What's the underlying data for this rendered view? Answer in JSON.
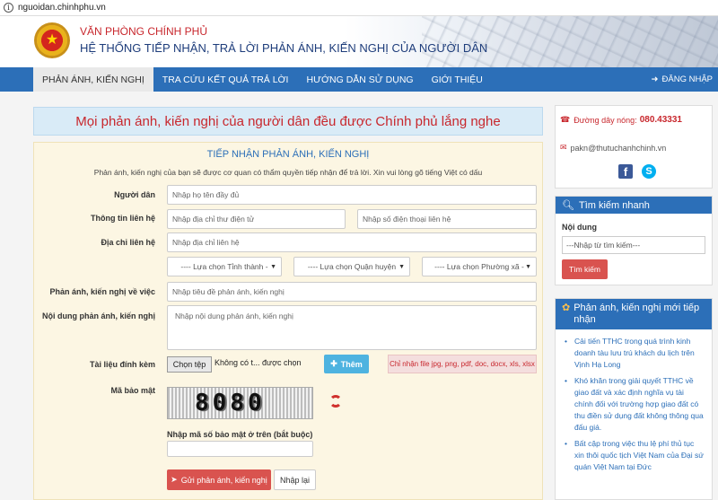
{
  "browser": {
    "url": "nguoidan.chinhphu.vn"
  },
  "header": {
    "org": "VĂN PHÒNG CHÍNH PHỦ",
    "system": "HỆ THỐNG TIẾP NHẬN, TRẢ LỜI PHẢN ÁNH, KIẾN NGHỊ CỦA NGƯỜI DÂN"
  },
  "nav": {
    "items": [
      {
        "label": "PHẢN ÁNH, KIẾN NGHỊ",
        "active": true
      },
      {
        "label": "TRA CỨU KẾT QUẢ TRẢ LỜI"
      },
      {
        "label": "HƯỚNG DẪN SỬ DỤNG"
      },
      {
        "label": "GIỚI THIỆU"
      }
    ],
    "login": "ĐĂNG NHẬP"
  },
  "slogan": "Mọi phản ánh, kiến nghị của người dân đều được Chính phủ lắng nghe",
  "form": {
    "title": "TIẾP NHẬN PHẢN ÁNH, KIẾN NGHỊ",
    "note": "Phản ánh, kiến nghị của bạn sẽ được cơ quan có thẩm quyền tiếp nhận để trả lời. Xin vui lòng gõ tiếng Việt có dấu",
    "name_label": "Người dân",
    "name_placeholder": "Nhập họ tên đầy đủ",
    "contact_label": "Thông tin liên hệ",
    "email_placeholder": "Nhập địa chỉ thư điện tử",
    "phone_placeholder": "Nhập số điện thoại liên hệ",
    "address_label": "Địa chỉ liên hệ",
    "address_placeholder": "Nhập địa chỉ liên hệ",
    "province": "---- Lựa chọn Tỉnh thành -",
    "district": "---- Lựa chọn Quận huyện",
    "ward": "---- Lựa chọn Phường xã -",
    "subject_label": "Phản ánh, kiến nghị về việc",
    "subject_placeholder": "Nhập tiêu đề phản ánh, kiến nghị",
    "content_label": "Nội dung phản ánh, kiến nghị",
    "content_placeholder": "Nhập nội dung phản ánh, kiến nghị",
    "attach_label": "Tài liệu đính kèm",
    "choose_file": "Chọn tệp",
    "no_file": "Không có t... được chọn",
    "add_button": "Thêm",
    "file_types": "Chỉ nhận file jpg, png, pdf, doc, docx, xls, xlsx",
    "captcha_label": "Mã bảo mật",
    "captcha_code": "8080",
    "captcha_input_label": "Nhập mã số bảo mật ở trên (bắt buộc)",
    "submit": "Gửi phản ánh, kiến nghị",
    "reset": "Nhập lại"
  },
  "sidebar": {
    "hotline_label": "Đường dây nóng:",
    "hotline_number": "080.43331",
    "email": "pakn@thutuchanhchinh.vn",
    "search_title": "Tìm kiếm nhanh",
    "search_label": "Nội dung",
    "search_placeholder": "---Nhập từ tìm kiếm---",
    "search_button": "Tìm kiếm",
    "latest_title": "Phản ánh, kiến nghị mới tiếp nhận",
    "latest": [
      "Cải tiến TTHC trong quá trình kinh doanh tàu lưu trú khách du lịch trên Vịnh Hạ Long",
      "Khó khăn trong giải quyết TTHC về giao đất và xác định nghĩa vụ tài chính đối với trường hợp giao đất có thu điền sử dụng đất không thông qua đấu giá.",
      "Bất cập trong việc thu lệ phí thủ tục xin thôi quốc tịch Việt Nam của Đại sứ quán Việt Nam tại Đức"
    ]
  }
}
